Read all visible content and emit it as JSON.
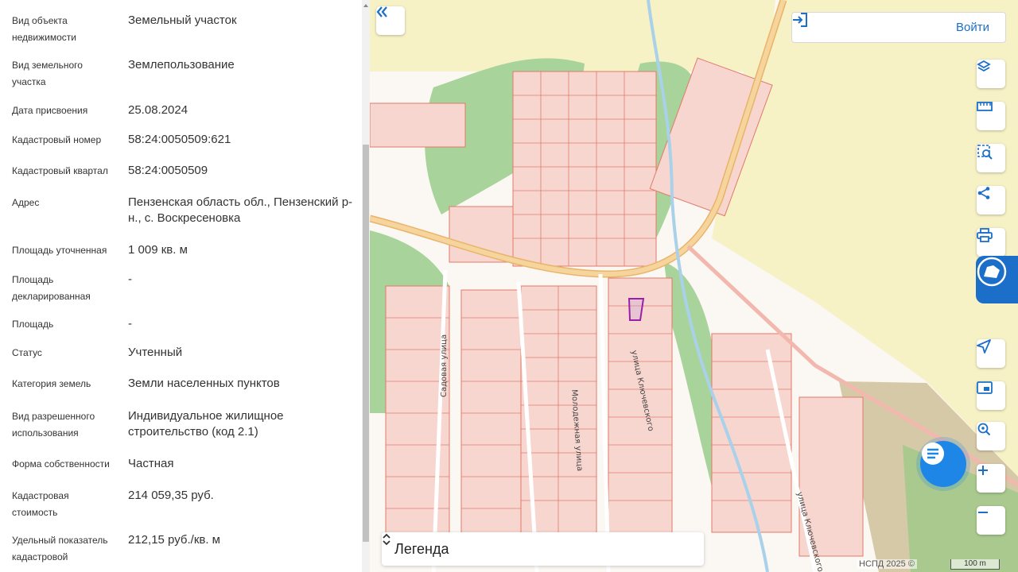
{
  "info": {
    "rows": [
      {
        "key": "Вид объекта недвижимости",
        "value": "Земельный участок"
      },
      {
        "key": "Вид земельного участка",
        "value": "Землепользование"
      },
      {
        "key": "Дата присвоения",
        "value": "25.08.2024"
      },
      {
        "key": "Кадастровый номер",
        "value": "58:24:0050509:621"
      },
      {
        "key": "Кадастровый квартал",
        "value": "58:24:0050509"
      },
      {
        "key": "Адрес",
        "value": "Пензенская область обл., Пензенский р-н., с. Воскресеновка"
      },
      {
        "key": "Площадь уточненная",
        "value": "1 009 кв. м"
      },
      {
        "key": "Площадь декларированная",
        "value": "-"
      },
      {
        "key": "Площадь",
        "value": "-"
      },
      {
        "key": "Статус",
        "value": "Учтенный"
      },
      {
        "key": "Категория земель",
        "value": "Земли населенных пунктов"
      },
      {
        "key": "Вид разрешенного использования",
        "value": "Индивидуальное жилищное строительство (код 2.1)"
      },
      {
        "key": "Форма собственности",
        "value": "Частная"
      },
      {
        "key": "Кадастровая стоимость",
        "value": "214 059,35 руб."
      },
      {
        "key": "Удельный показатель кадастровой",
        "value": "212,15 руб./кв. м"
      }
    ]
  },
  "map": {
    "login_label": "Войти",
    "legend_label": "Легенда",
    "attribution": "НСПД 2025 ©",
    "scale_label": "100 m",
    "streets": {
      "sadovaya": "Садовая улица",
      "molodezhnaya": "Молодежная улица",
      "klyuchevskogo_1": "улица Ключевского",
      "klyuchevskogo_2": "улица Ключевского"
    },
    "tools": [
      "layers-icon",
      "ruler-icon",
      "select-area-icon",
      "share-icon",
      "print-icon",
      "location-arrow-icon",
      "minimap-icon",
      "search-location-icon",
      "zoom-in-icon",
      "zoom-out-icon"
    ],
    "colors": {
      "accent": "#1b6fc9",
      "parcel_border": "#e07a6a",
      "parcel_fill": "#f8d6d0",
      "selected_parcel": "#9b1fa8",
      "green": "#a8d39a",
      "road": "#f3c983",
      "field": "#f7f1c6"
    }
  }
}
